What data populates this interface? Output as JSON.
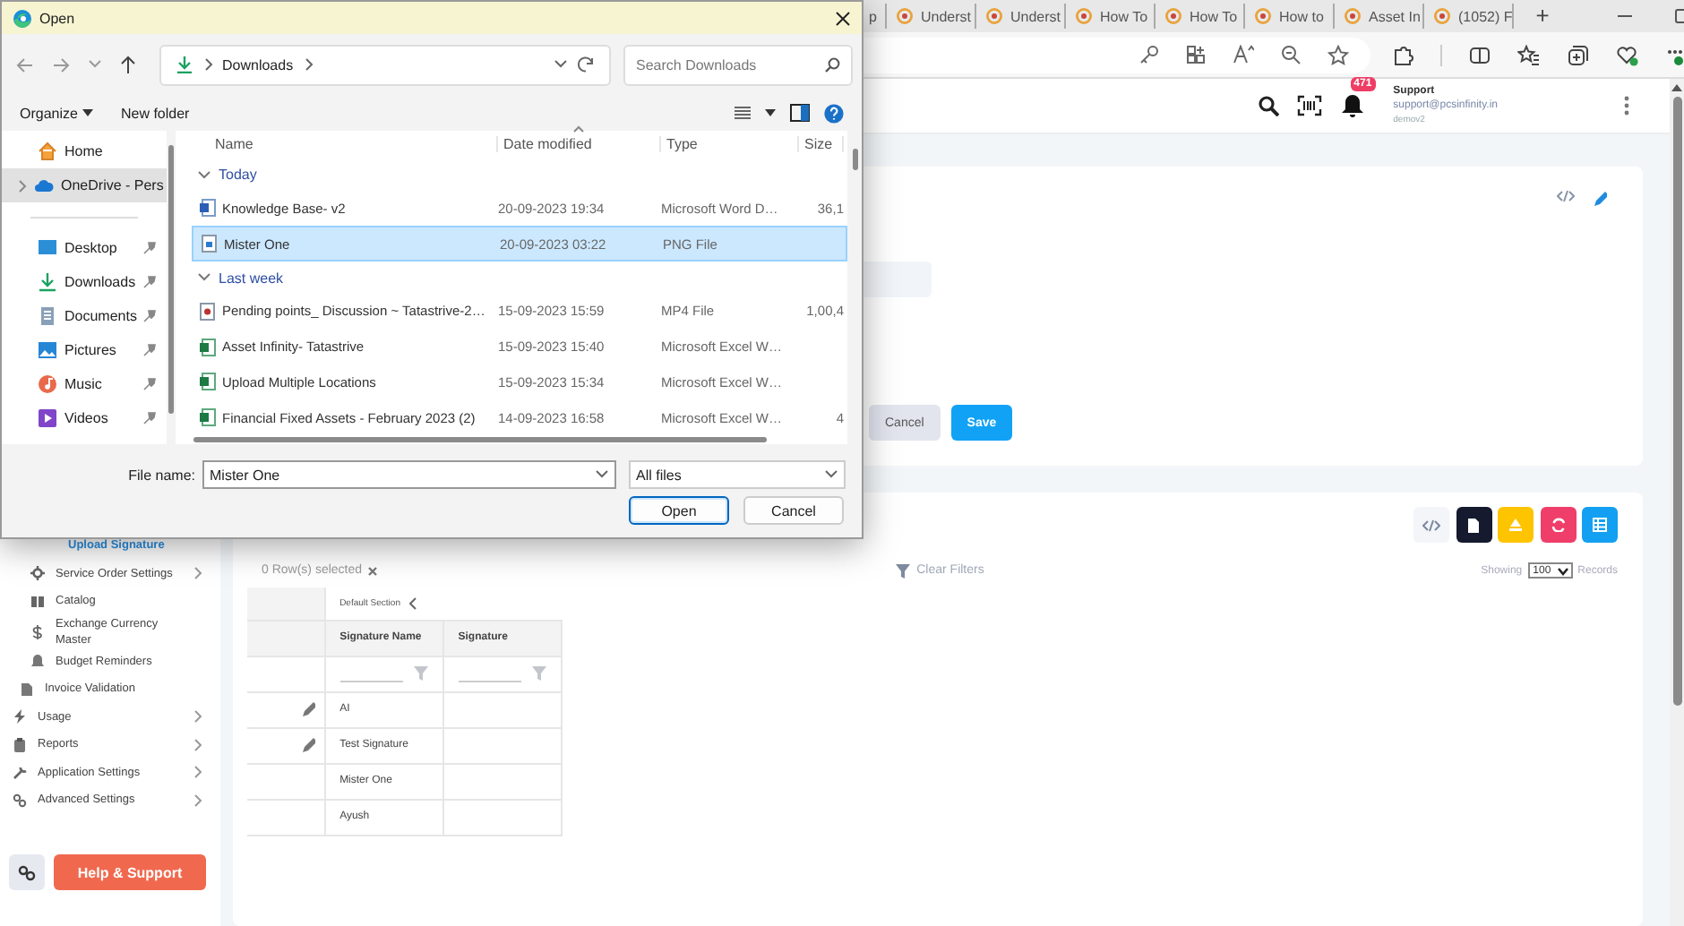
{
  "browser": {
    "tabs": [
      {
        "title": "p"
      },
      {
        "title": "Underst"
      },
      {
        "title": "Underst"
      },
      {
        "title": "How To"
      },
      {
        "title": "How To"
      },
      {
        "title": "How to"
      },
      {
        "title": "Asset In"
      },
      {
        "title": "(1052) F"
      }
    ],
    "new_tab": "+"
  },
  "app": {
    "header": {
      "badge": "471",
      "user_name": "Support",
      "user_email": "support@pcsinfinity.in",
      "user_org": "demov2"
    },
    "sidebar": {
      "items": [
        {
          "label": "Upload Signature",
          "kind": "leaf",
          "selected": true,
          "expandable": false
        },
        {
          "label": "Service Order Settings",
          "kind": "sub",
          "selected": false,
          "expandable": true
        },
        {
          "label": "Catalog",
          "kind": "sub",
          "selected": false,
          "expandable": false
        },
        {
          "label": "Exchange Currency Master",
          "kind": "sub",
          "selected": false,
          "expandable": false
        },
        {
          "label": "Budget Reminders",
          "kind": "sub",
          "selected": false,
          "expandable": false
        },
        {
          "label": "Invoice Validation",
          "kind": "mid",
          "selected": false,
          "expandable": false
        },
        {
          "label": "Usage",
          "kind": "top",
          "selected": false,
          "expandable": true
        },
        {
          "label": "Reports",
          "kind": "top",
          "selected": false,
          "expandable": true
        },
        {
          "label": "Application Settings",
          "kind": "top",
          "selected": false,
          "expandable": true
        },
        {
          "label": "Advanced Settings",
          "kind": "top",
          "selected": false,
          "expandable": true
        }
      ],
      "help_button": "Help & Support"
    },
    "form": {
      "buttons": [
        {
          "label": "Cancel",
          "kind": "secondary"
        },
        {
          "label": "Save",
          "kind": "primary"
        }
      ]
    },
    "list": {
      "selection": "0 Row(s) selected",
      "clear_filters": "Clear Filters",
      "showing": "Showing",
      "page_size": "100",
      "records": "Records",
      "section": "Default Section",
      "columns": [
        "Signature Name",
        "Signature"
      ],
      "rows": [
        {
          "name": "AI",
          "editable": true
        },
        {
          "name": "Test Signature",
          "editable": true
        },
        {
          "name": "Mister One",
          "editable": false
        },
        {
          "name": "Ayush",
          "editable": false
        }
      ]
    }
  },
  "dialog": {
    "title": "Open",
    "path": "Downloads",
    "search_placeholder": "Search Downloads",
    "toolbar": [
      "Organize",
      "New folder"
    ],
    "nav": [
      {
        "label": "Home",
        "selected": false,
        "expandable": false
      },
      {
        "label": "OneDrive - Pers",
        "selected": true,
        "expandable": true
      }
    ],
    "quick_access": [
      {
        "label": "Desktop",
        "pinned": true
      },
      {
        "label": "Downloads",
        "pinned": true
      },
      {
        "label": "Documents",
        "pinned": true
      },
      {
        "label": "Pictures",
        "pinned": true
      },
      {
        "label": "Music",
        "pinned": true
      },
      {
        "label": "Videos",
        "pinned": true
      }
    ],
    "columns": [
      "Name",
      "Date modified",
      "Type",
      "Size"
    ],
    "groups": [
      {
        "label": "Today",
        "files": [
          {
            "name": "Knowledge Base- v2",
            "kind": "word",
            "date": "20-09-2023 19:34",
            "type": "Microsoft Word D…",
            "size": "36,1",
            "selected": false
          },
          {
            "name": "Mister One",
            "kind": "image",
            "date": "20-09-2023 03:22",
            "type": "PNG File",
            "selected": true
          }
        ]
      },
      {
        "label": "Last week",
        "files": [
          {
            "name": "Pending points_ Discussion ~ Tatastrive-2…",
            "kind": "video",
            "date": "15-09-2023 15:59",
            "type": "MP4 File",
            "size": "1,00,4",
            "selected": false
          },
          {
            "name": "Asset Infinity- Tatastrive",
            "kind": "excel",
            "date": "15-09-2023 15:40",
            "type": "Microsoft Excel W…",
            "selected": false
          },
          {
            "name": "Upload Multiple Locations",
            "kind": "excel",
            "date": "15-09-2023 15:34",
            "type": "Microsoft Excel W…",
            "selected": false
          },
          {
            "name": "Financial Fixed Assets - February 2023 (2)",
            "kind": "excel",
            "date": "14-09-2023 16:58",
            "type": "Microsoft Excel W…",
            "size": "4",
            "selected": false
          }
        ]
      }
    ],
    "file_name_label": "File name:",
    "file_name": "Mister One",
    "filter": "All files",
    "buttons": [
      {
        "label": "Open",
        "default": true
      },
      {
        "label": "Cancel",
        "default": false
      }
    ]
  }
}
